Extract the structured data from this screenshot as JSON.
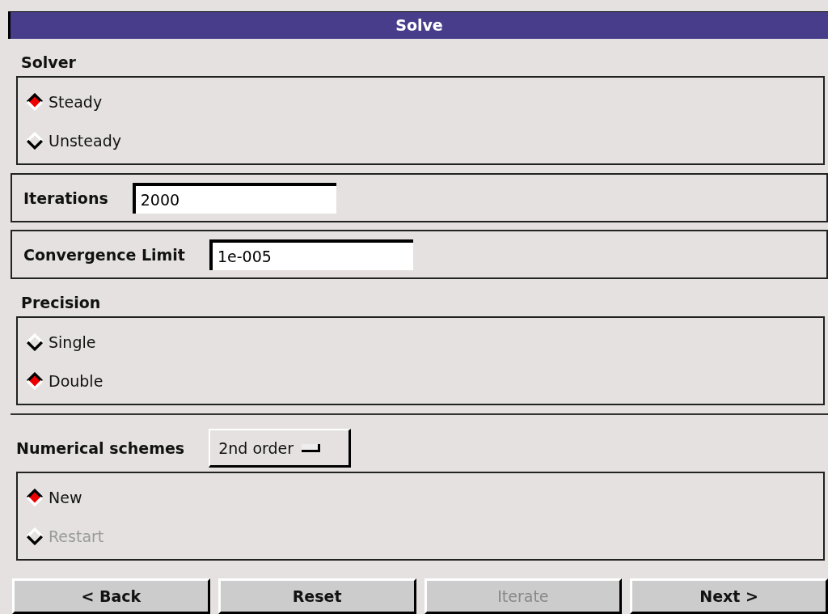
{
  "title": "Solve",
  "solver": {
    "label": "Solver",
    "options": [
      {
        "label": "Steady",
        "selected": true,
        "disabled": false
      },
      {
        "label": "Unsteady",
        "selected": false,
        "disabled": false
      }
    ]
  },
  "iterations": {
    "label": "Iterations",
    "value": "2000"
  },
  "convergence": {
    "label": "Convergence Limit",
    "value": "1e-005"
  },
  "precision": {
    "label": "Precision",
    "options": [
      {
        "label": "Single",
        "selected": false,
        "disabled": false
      },
      {
        "label": "Double",
        "selected": true,
        "disabled": false
      }
    ]
  },
  "schemes": {
    "label": "Numerical schemes",
    "value": "2nd order",
    "options": [
      {
        "label": "New",
        "selected": true,
        "disabled": false
      },
      {
        "label": "Restart",
        "selected": false,
        "disabled": true
      }
    ]
  },
  "buttons": [
    {
      "label": "< Back",
      "disabled": false
    },
    {
      "label": "Reset",
      "disabled": false
    },
    {
      "label": "Iterate",
      "disabled": true
    },
    {
      "label": "Next >",
      "disabled": false
    }
  ]
}
